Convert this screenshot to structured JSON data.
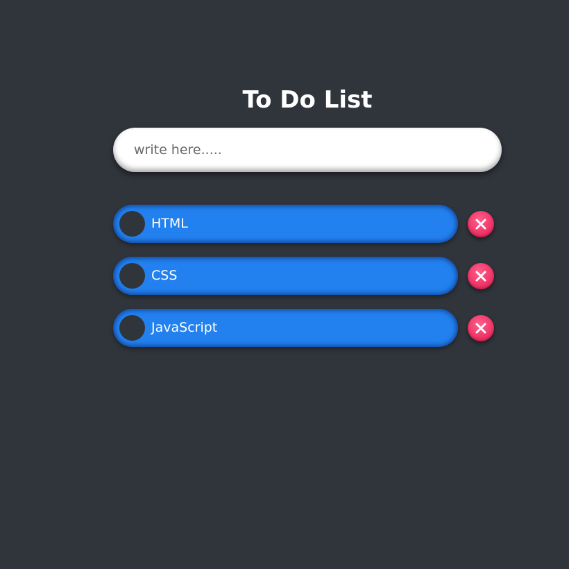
{
  "header": {
    "title": "To Do List"
  },
  "input": {
    "placeholder": "write here.....",
    "value": ""
  },
  "todos": [
    {
      "label": "HTML",
      "delete_icon": "close-icon"
    },
    {
      "label": "CSS",
      "delete_icon": "close-icon"
    },
    {
      "label": "JavaScript",
      "delete_icon": "close-icon"
    }
  ],
  "colors": {
    "background": "#30343b",
    "item": "#2281ef",
    "delete": "#ef3468",
    "text": "#ffffff"
  }
}
